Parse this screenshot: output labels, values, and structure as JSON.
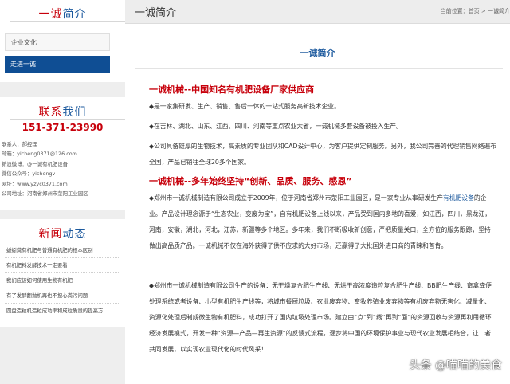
{
  "sidebar": {
    "about": {
      "title_red": "一诚",
      "title_blue": "简介",
      "items": [
        {
          "label": "企业文化"
        },
        {
          "label": "走进一诚"
        }
      ]
    },
    "contact": {
      "title_red": "联系",
      "title_blue": "我们",
      "phone": "151-371-23990",
      "lines": [
        "联系人：郝经理",
        "邮箱：yicheng0371@126.com",
        "新浪微博：@一诚有机肥设备",
        "微信公众号：yichengv",
        "网址：www.yzyc0371.com",
        "公司地址：河南省郑州市荥阳工业园区"
      ]
    },
    "news": {
      "title_red": "新闻",
      "title_blue": "动态",
      "items": [
        "蚯蚓粪有机肥与普通有机肥的根本区别",
        "有机肥料发酵技术一定要看",
        "我们应该如何使用生物有机肥",
        "有了发酵翻抛机再也不担心粪污问题",
        "圆盘造粒机造粒成功率和成粒质量的提高方..."
      ]
    }
  },
  "main": {
    "heading": "一诚简介",
    "breadcrumb": "当前位置：首页 > 一诚简介",
    "content_title": "一诚简介",
    "heading1": "一诚机械--中国知名有机肥设备厂家供应商",
    "para1": "◆是一家集研发、生产、销售、售后一体的一站式服务高新技术企业。",
    "para2": "◆在吉林、湖北、山东、江西、四川、河南等重点农业大省，一诚机械多套设备被投入生产。",
    "para3": "◆公司具备雄厚的生物技术，高素质的专业团队和CAD设计中心，为客户提供定制服务。另外，我公司完善的代理销售网络遍布全国，产品已销往全球20多个国家。",
    "heading2": "一诚机械--多年始终坚持“创新、品质、服务、感恩”",
    "para4_a": "◆郑州市一诚机械制造有限公司成立于2009年，位于河南省郑州市荥阳工业园区，是一家专业从事研发生产",
    "para4_link": "有机肥设备",
    "para4_b": "的企业。产品设计理念源于“生态农业，变废为宝”，自有机肥设备上线以来，产品受到国内多地的喜爱，如江西，四川，黑龙江，河南，安徽，湖北，河北，江苏，新疆等多个地区。多年来，我们不断吸收新创意，严把质量关口，全方位的服务跟踪，坚持做出高品质产品。一诚机械不仅在海外获得了供不应求的大好市场，还赢得了大批国外进口商的青睐和首肯。",
    "para5": "◆郑州市一诚机械制造有限公司生产的设备：无干燥复合肥生产线、无烘干高浓度造粒复合肥生产线、BB肥生产线、畜禽粪便处理系统或者设备、小型有机肥生产线等，将城市餐厨垃圾、农业废弃物、畜牧养殖业废弃物等有机废弃物无害化、减量化、资源化处理后制成微生物有机肥料，成功打开了国内垃圾处理市场。建立由“点”到“线”再到“面”的资源回收与资源再利用循环经济发展模式，开发一种“资源—产品—再生资源”的反馈式流程，逐步将中国的环境保护事业与现代农业发展相结合，让二者共同发展，以实现农业现代化的时代风采！"
  },
  "watermark": "头条 @喵喵的美食"
}
